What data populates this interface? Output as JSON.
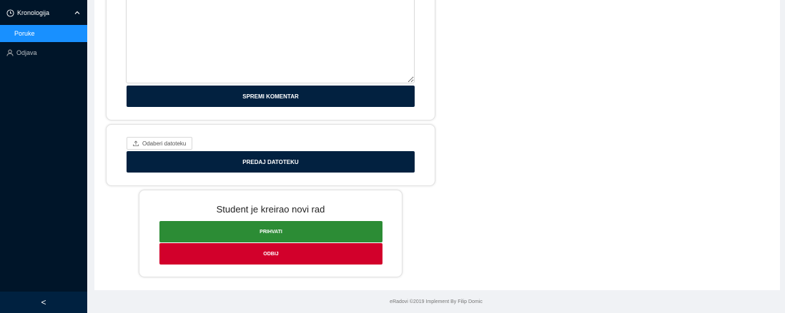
{
  "sidebar": {
    "submenu": {
      "label": "Kronologija",
      "icon": "clock-circle-icon",
      "chevron": "chevron-up-icon"
    },
    "active_item": {
      "label": "Poruke"
    },
    "logout": {
      "label": "Odjava",
      "icon": "user-icon"
    },
    "collapse": {
      "glyph": "<",
      "icon": "chevron-left-icon"
    }
  },
  "comment": {
    "value": "",
    "save_label": "SPREMI KOMENTAR"
  },
  "upload": {
    "choose_label": "Odaberi datoteku",
    "choose_icon": "upload-icon",
    "submit_label": "PREDAJ DATOTEKU"
  },
  "notice": {
    "title": "Student je kreirao novi rad",
    "accept_label": "PRIHVATI",
    "reject_label": "ODBIJ"
  },
  "footer": {
    "text": "eRadovi ©2019 Implement By Filip Domic"
  },
  "colors": {
    "sidebar_bg": "#001529",
    "active_item": "#1890ff",
    "primary_dark": "#022140",
    "accept": "#2c8c35",
    "reject": "#d2002b"
  }
}
